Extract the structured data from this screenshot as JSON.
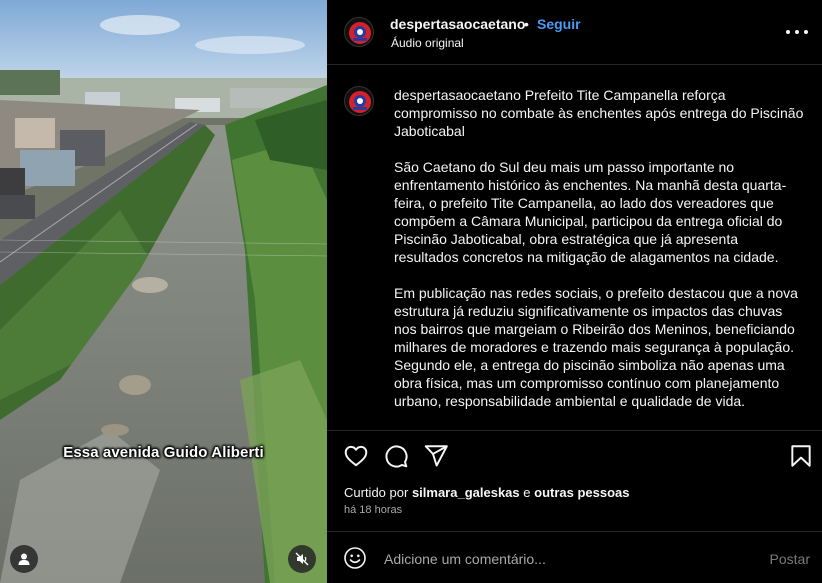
{
  "media": {
    "overlay_text": "Essa avenida Guido Aliberti"
  },
  "header": {
    "username": "despertasaocaetano",
    "separator": "•",
    "follow_label": "Seguir",
    "audio_label": "Áudio original"
  },
  "caption": {
    "author": "despertasaocaetano",
    "paragraphs": [
      "Prefeito Tite Campanella reforça compromisso no combate às enchentes após entrega do Piscinão Jaboticabal",
      "São Caetano do Sul deu mais um passo importante no enfrentamento histórico às enchentes. Na manhã desta quarta-feira, o prefeito Tite Campanella, ao lado dos vereadores que compõem a Câmara Municipal, participou da entrega oficial do Piscinão Jaboticabal, obra estratégica que já apresenta resultados concretos na mitigação de alagamentos na cidade.",
      "Em publicação nas redes sociais, o prefeito destacou que a nova estrutura já reduziu significativamente os impactos das chuvas nos bairros que margeiam o Ribeirão dos Meninos, beneficiando milhares de moradores e trazendo mais segurança à população. Segundo ele, a entrega do piscinão simboliza não apenas uma obra física, mas um compromisso contínuo com planejamento urbano, responsabilidade ambiental e qualidade de vida."
    ]
  },
  "likes": {
    "prefix": "Curtido por",
    "user": "silmara_galeskas",
    "connector": "e",
    "others": "outras pessoas"
  },
  "time_ago": "há 18 horas",
  "comment": {
    "placeholder": "Adicione um comentário...",
    "post_label": "Postar"
  },
  "colors": {
    "accent": "#4a9bf5",
    "background": "#000000",
    "muted": "#a8a8a8",
    "avatar_red": "#d8202a",
    "avatar_blue": "#2a3a9e"
  },
  "icons": [
    "heart-icon",
    "comment-icon",
    "share-icon",
    "bookmark-icon",
    "emoji-icon",
    "more-icon",
    "user-tag-icon",
    "mute-icon"
  ]
}
